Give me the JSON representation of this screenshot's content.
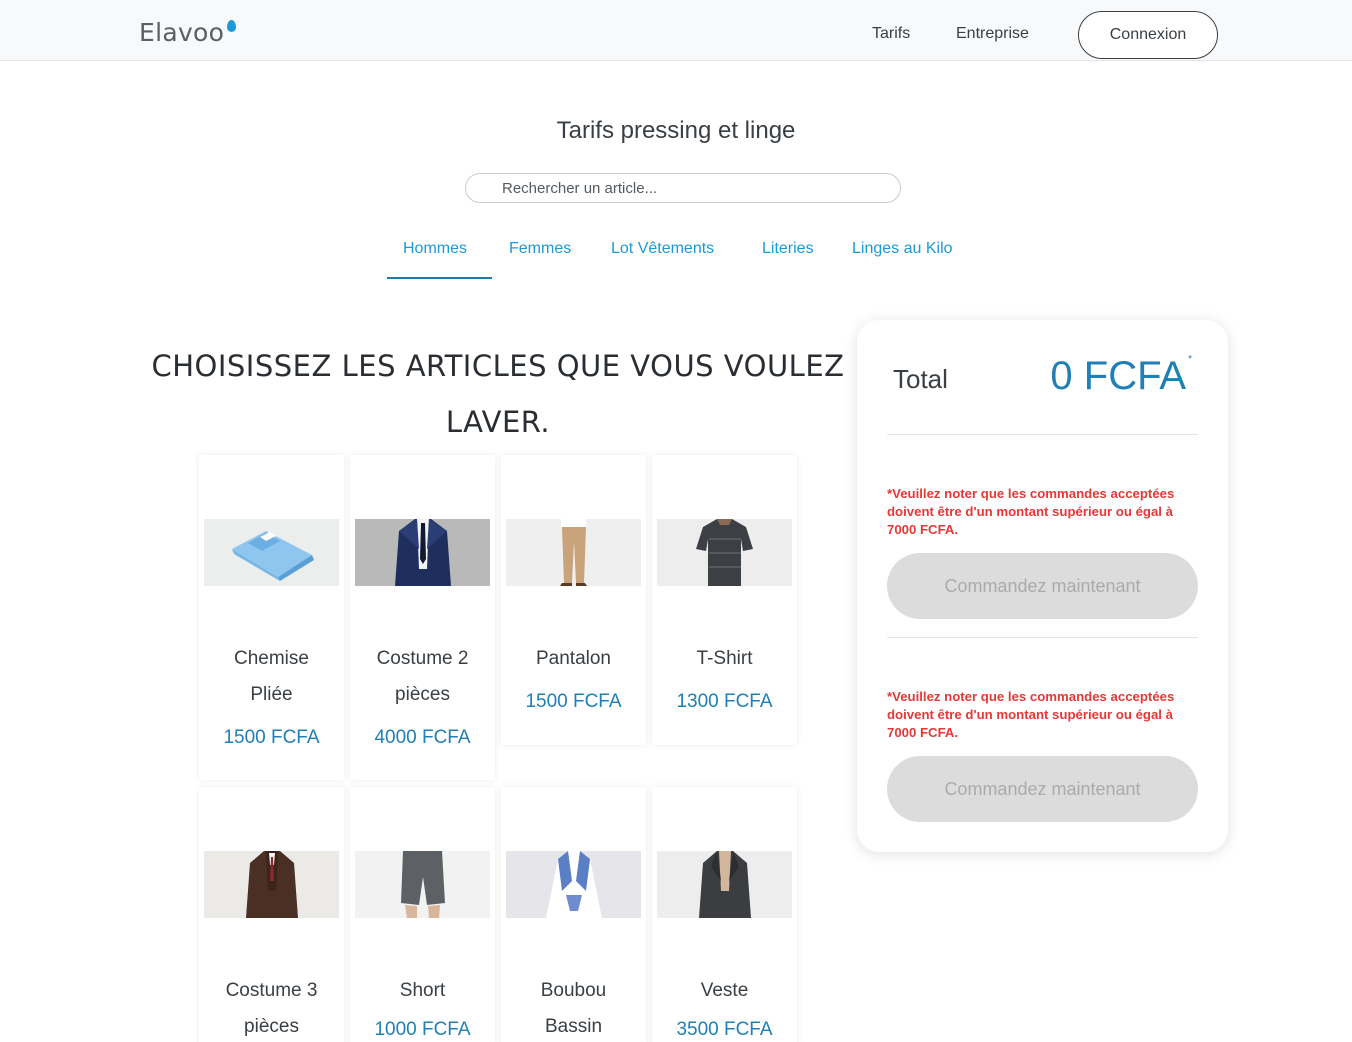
{
  "header": {
    "logo": "Elavoo",
    "nav": {
      "tarifs": "Tarifs",
      "entreprise": "Entreprise"
    },
    "login_label": "Connexion"
  },
  "main": {
    "title": "Tarifs pressing et linge",
    "search_placeholder": "Rechercher un article...",
    "tabs": [
      "Hommes",
      "Femmes",
      "Lot Vêtements",
      "Literies",
      "Linges au Kilo"
    ],
    "active_tab": "Hommes",
    "heading_line1": "CHOISISSEZ LES ARTICLES QUE VOUS VOULEZ",
    "heading_line2": "LAVER."
  },
  "products": [
    {
      "name_line1": "Chemise",
      "name_line2": "Pliée",
      "price": "1500 FCFA",
      "icon": "folded-shirt-image"
    },
    {
      "name_line1": "Costume 2",
      "name_line2": "pièces",
      "price": "4000 FCFA",
      "icon": "suit-image"
    },
    {
      "name_line1": "Pantalon",
      "name_line2": "",
      "price": "1500 FCFA",
      "icon": "trousers-image"
    },
    {
      "name_line1": "T-Shirt",
      "name_line2": "",
      "price": "1300 FCFA",
      "icon": "tshirt-image"
    },
    {
      "name_line1": "Costume 3",
      "name_line2": "pièces",
      "price": "",
      "icon": "three-piece-suit-image"
    },
    {
      "name_line1": "Short",
      "name_line2": "",
      "price": "1000 FCFA",
      "icon": "shorts-image"
    },
    {
      "name_line1": "Boubou",
      "name_line2": "Bassin",
      "price": "",
      "icon": "boubou-image"
    },
    {
      "name_line1": "Veste",
      "name_line2": "",
      "price": "3500 FCFA",
      "icon": "blazer-image"
    }
  ],
  "cart": {
    "total_label": "Total",
    "total_value": "0 FCFA",
    "total_marker": "*",
    "note": "*Veuillez noter que les commandes acceptées doivent être d'un montant supérieur ou égal à 7000 FCFA.",
    "order_label": "Commandez maintenant"
  },
  "colors": {
    "accent": "#1f7fb6",
    "warning": "#e53935",
    "disabled_button": "#dcdcdc"
  }
}
